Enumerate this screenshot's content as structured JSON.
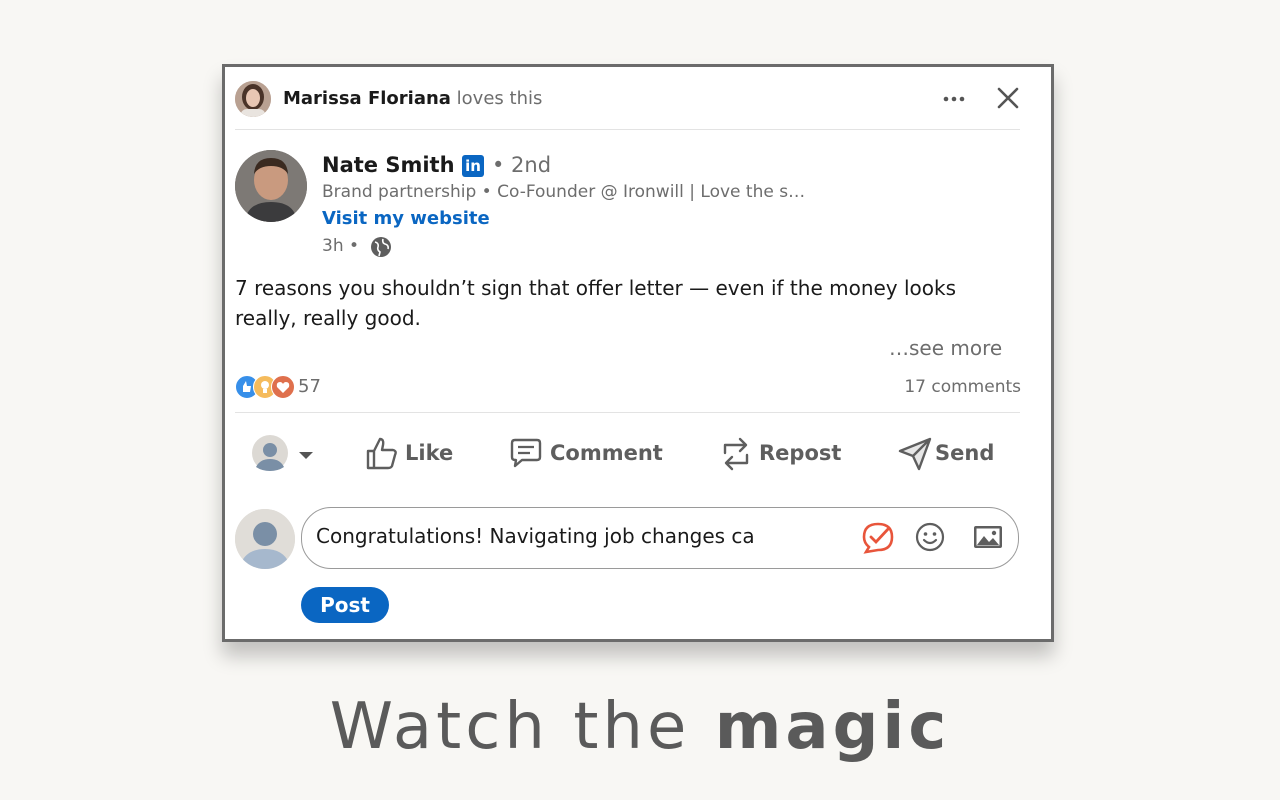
{
  "context": {
    "actor_name": "Marissa Floriana",
    "action_text": "loves this"
  },
  "author": {
    "name": "Nate Smith",
    "badge": "in",
    "degree": "• 2nd",
    "headline": "Brand partnership • Co-Founder @ Ironwill | Love the s…",
    "website_label": "Visit my website",
    "time": "3h •"
  },
  "post": {
    "body": "7 reasons you shouldn’t sign that offer letter — even if the money looks really, really good.",
    "see_more": "…see more"
  },
  "social": {
    "reaction_count": "57",
    "comments": "17 comments",
    "reaction_colors": [
      "#378fe9",
      "#f5bb5c",
      "#df704d"
    ]
  },
  "actions": {
    "like": "Like",
    "comment": "Comment",
    "repost": "Repost",
    "send": "Send"
  },
  "composer": {
    "value": "Congratulations! Navigating job changes ca",
    "post_label": "Post"
  },
  "tagline": {
    "normal": "Watch the ",
    "bold": "magic"
  },
  "colors": {
    "accent": "#0a66c2",
    "muted_text": "#6d6d6d"
  }
}
